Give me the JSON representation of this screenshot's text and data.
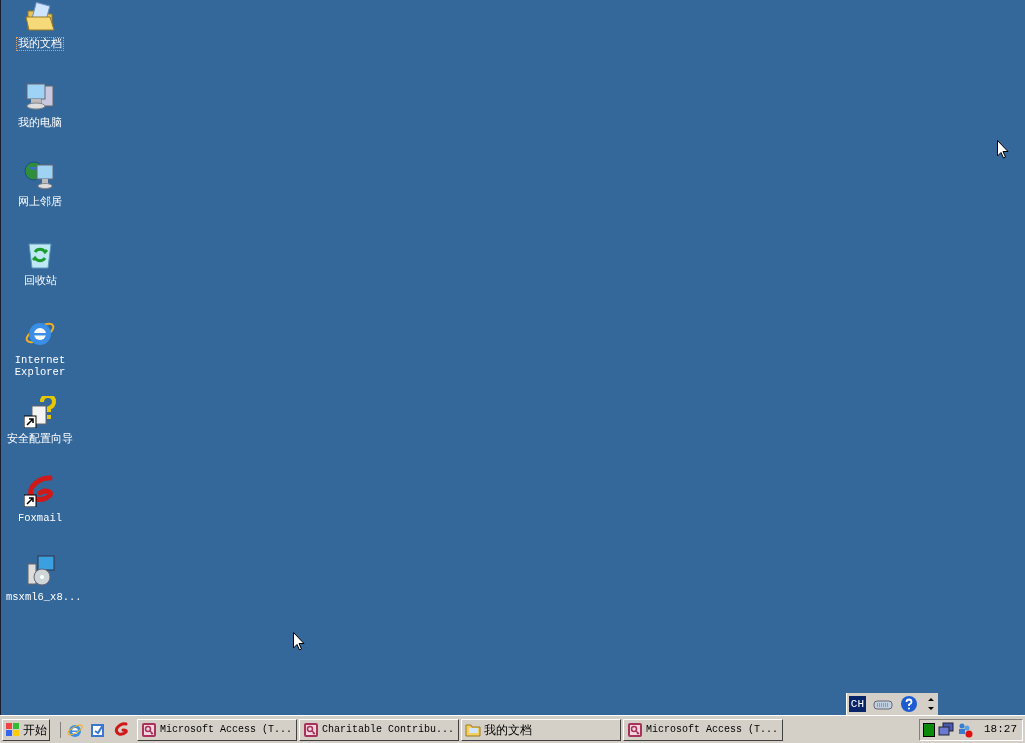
{
  "desktop_icons": [
    {
      "kind": "folder",
      "label": "我的文档",
      "selected": true,
      "shortcut": false
    },
    {
      "kind": "computer",
      "label": "我的电脑",
      "selected": false,
      "shortcut": false
    },
    {
      "kind": "network",
      "label": "网上邻居",
      "selected": false,
      "shortcut": false
    },
    {
      "kind": "recycle",
      "label": "回收站",
      "selected": false,
      "shortcut": false
    },
    {
      "kind": "ie",
      "label": "Internet Explorer",
      "selected": false,
      "shortcut": false
    },
    {
      "kind": "wizard",
      "label": "安全配置向导",
      "selected": false,
      "shortcut": true
    },
    {
      "kind": "foxmail",
      "label": "Foxmail",
      "selected": false,
      "shortcut": true
    },
    {
      "kind": "installer",
      "label": "msxml6_x8...",
      "selected": false,
      "shortcut": false
    }
  ],
  "language_bar": {
    "language": "CH"
  },
  "taskbar": {
    "start_label": "开始",
    "quick_launch": [
      {
        "kind": "ie"
      },
      {
        "kind": "outlook"
      },
      {
        "kind": "foxmail"
      }
    ],
    "tasks": [
      {
        "kind": "access",
        "label": "Microsoft Access (T..."
      },
      {
        "kind": "access",
        "label": "Charitable Contribu..."
      },
      {
        "kind": "folder",
        "label": "我的文档"
      },
      {
        "kind": "access",
        "label": "Microsoft Access (T..."
      }
    ],
    "clock": "18:27"
  }
}
